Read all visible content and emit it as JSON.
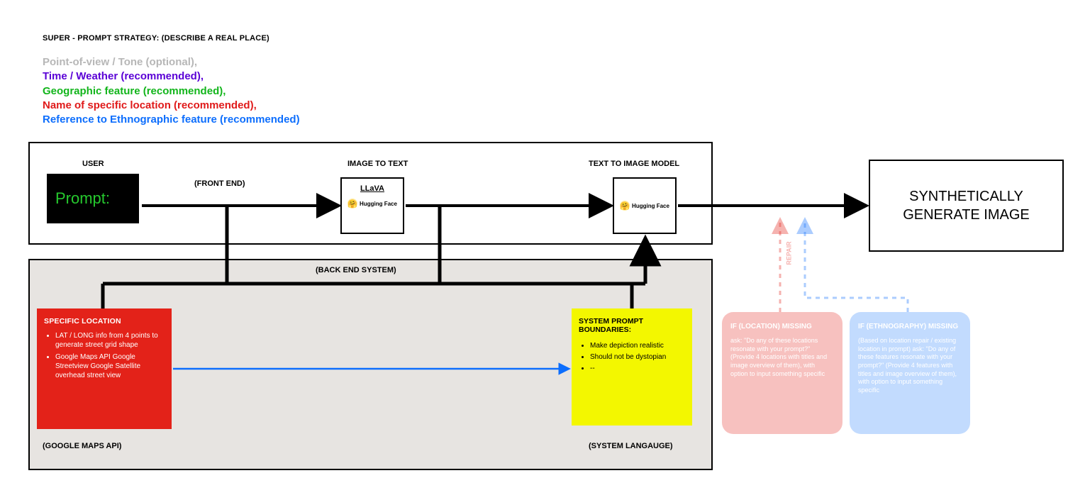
{
  "header": {
    "title": "SUPER - PROMPT STRATEGY: (DESCRIBE A REAL PLACE)",
    "lines": {
      "pov": "Point-of-view / Tone (optional),",
      "time": "Time / Weather (recommended),",
      "geo": "Geographic feature (recommended),",
      "loc": "Name of specific location (recommended),",
      "ethno": "Reference to Ethnographic feature (recommended)"
    }
  },
  "labels": {
    "user": "USER",
    "img2txt": "IMAGE TO TEXT",
    "txt2img": "TEXT TO IMAGE MODEL",
    "frontend": "(FRONT END)",
    "backend": "(BACK END SYSTEM)",
    "gmaps": "(GOOGLE MAPS API)",
    "syslang": "(SYSTEM LANGAUGE)",
    "repair": "REPAIR"
  },
  "prompt_box": {
    "text": "Prompt:"
  },
  "llava": {
    "title": "LLaVA",
    "hf": "Hugging Face"
  },
  "hf_box": {
    "hf": "Hugging Face"
  },
  "output": {
    "text": "SYNTHETICALLY GENERATE IMAGE"
  },
  "red_card": {
    "title": "SPECIFIC LOCATION",
    "b1": "LAT / LONG info from 4 points to generate street grid shape",
    "b2": "Google Maps API Google Streetview Google Satellite overhead street view"
  },
  "yellow_card": {
    "title": "SYSTEM PROMPT BOUNDARIES:",
    "b1": "Make depiction realistic",
    "b2": "Should not be dystopian",
    "b3": "--"
  },
  "fade_red": {
    "title": "IF (LOCATION) MISSING",
    "body": "ask: \"Do any of these locations resonate with your prompt?\" (Provide 4 locations with titles and image overview of them), with option to input something specific"
  },
  "fade_blue": {
    "title": "IF (ETHNOGRAPHY) MISSING",
    "body": "(Based on location repair / existing location in prompt) ask: \"Do any of these features resonate with your prompt?\" (Provide 4 features with titles and image overview of them), with option to input something specific"
  }
}
